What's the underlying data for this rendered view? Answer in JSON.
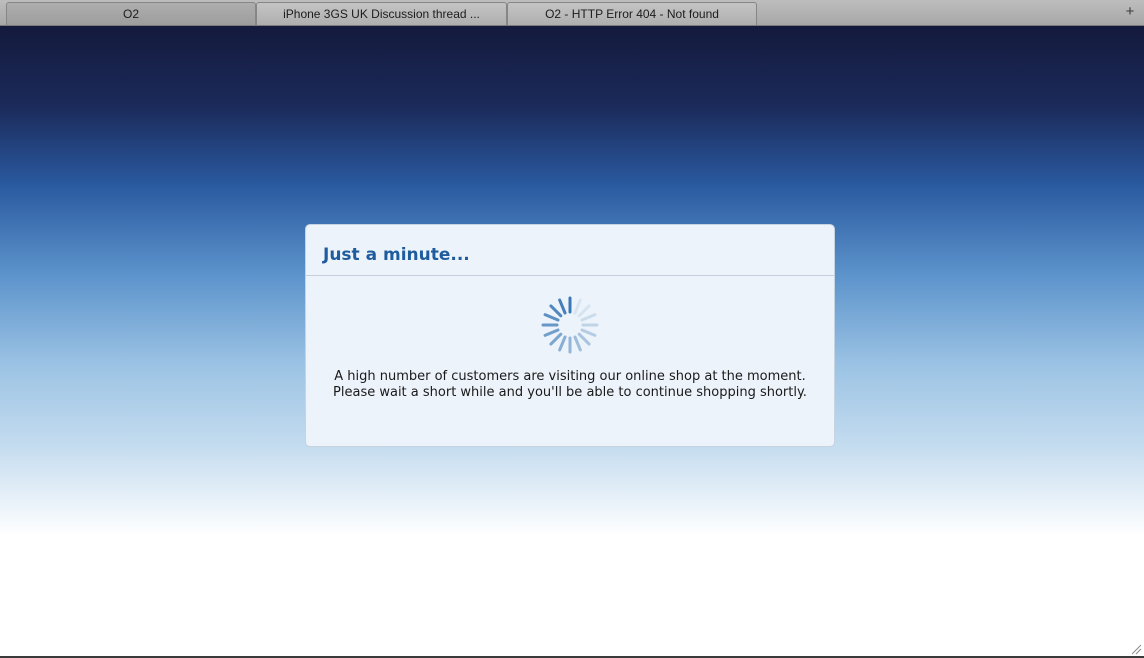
{
  "tabs": [
    {
      "label": "O2",
      "active": true
    },
    {
      "label": "iPhone 3GS UK Discussion thread ...",
      "active": false
    },
    {
      "label": "O2 - HTTP Error 404 - Not found",
      "active": false
    }
  ],
  "new_tab_icon": "plus-icon",
  "dialog": {
    "title": "Just a minute...",
    "spinner_icon": "loading-spinner-icon",
    "message_line1": "A high number of customers are visiting our online shop at the moment.",
    "message_line2": "Please wait a short while and you'll be able to continue shopping shortly."
  },
  "colors": {
    "title": "#1f5c9e",
    "spinner": "#3a78b5",
    "dialog_bg": "#edf3fa"
  }
}
